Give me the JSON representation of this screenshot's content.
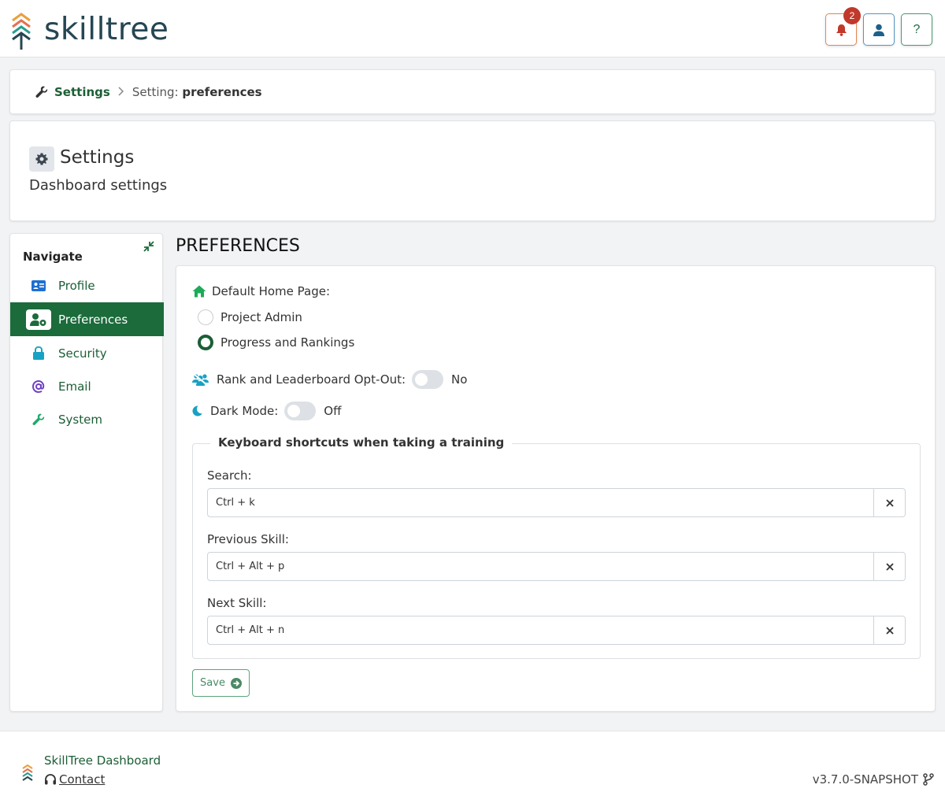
{
  "header": {
    "logo_text": "skilltree",
    "notification_count": "2",
    "help_label": "?"
  },
  "breadcrumb": {
    "root": "Settings",
    "current_prefix": "Setting:",
    "current_value": "preferences"
  },
  "title_card": {
    "title": "Settings",
    "subtitle": "Dashboard settings"
  },
  "sidebar": {
    "heading": "Navigate",
    "items": [
      {
        "label": "Profile",
        "icon": "id-card-icon",
        "active": false
      },
      {
        "label": "Preferences",
        "icon": "user-gear-icon",
        "active": true
      },
      {
        "label": "Security",
        "icon": "lock-icon",
        "active": false
      },
      {
        "label": "Email",
        "icon": "at-icon",
        "active": false
      },
      {
        "label": "System",
        "icon": "wrench-icon",
        "active": false
      }
    ]
  },
  "preferences": {
    "section_title": "PREFERENCES",
    "home_page_label": "Default Home Page:",
    "home_options": [
      {
        "label": "Project Admin",
        "checked": false
      },
      {
        "label": "Progress and Rankings",
        "checked": true
      }
    ],
    "rank_optout_label": "Rank and Leaderboard Opt-Out:",
    "rank_optout_value": "No",
    "dark_mode_label": "Dark Mode:",
    "dark_mode_value": "Off",
    "shortcuts_legend": "Keyboard shortcuts when taking a training",
    "shortcuts": [
      {
        "label": "Search:",
        "value": "Ctrl + k"
      },
      {
        "label": "Previous Skill:",
        "value": "Ctrl + Alt + p"
      },
      {
        "label": "Next Skill:",
        "value": "Ctrl + Alt + n"
      }
    ],
    "save_label": "Save"
  },
  "footer": {
    "title": "SkillTree Dashboard",
    "contact": "Contact",
    "version": "v3.7.0-SNAPSHOT"
  },
  "colors": {
    "brand_green": "#1b6b3b",
    "link_green": "#1b5e35",
    "bell_accent": "#e08a55",
    "badge_red": "#c0392b"
  }
}
